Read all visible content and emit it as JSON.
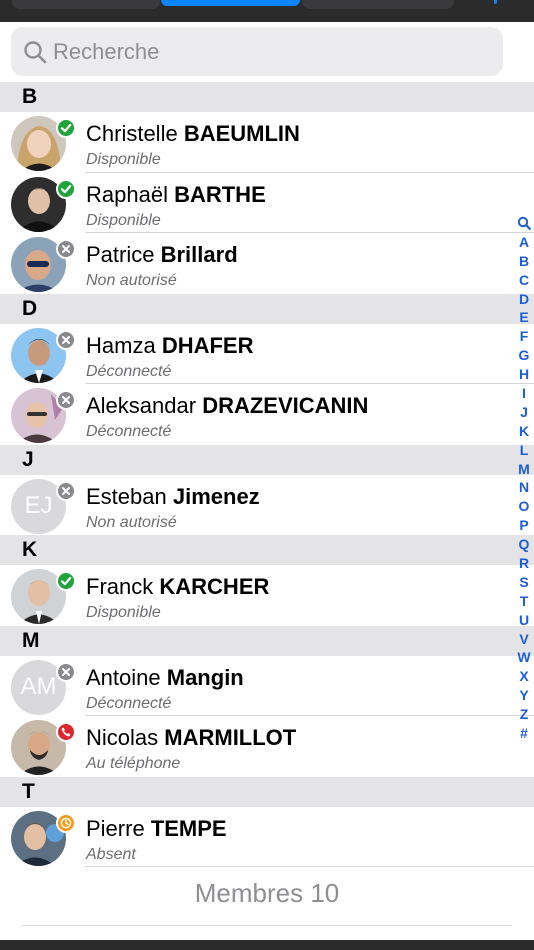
{
  "search": {
    "placeholder": "Recherche"
  },
  "sections": [
    {
      "letter": "B",
      "contacts": [
        {
          "first": "Christelle",
          "last": "BAEUMLIN",
          "state": "Disponible",
          "status": "ok",
          "initials": ""
        },
        {
          "first": "Raphaël",
          "last": "BARTHE",
          "state": "Disponible",
          "status": "ok",
          "initials": ""
        },
        {
          "first": "Patrice",
          "last": "Brillard",
          "state": "Non autorisé",
          "status": "off",
          "initials": ""
        }
      ]
    },
    {
      "letter": "D",
      "contacts": [
        {
          "first": "Hamza",
          "last": "DHAFER",
          "state": "Déconnecté",
          "status": "off",
          "initials": ""
        },
        {
          "first": "Aleksandar",
          "last": "DRAZEVICANIN",
          "state": "Déconnecté",
          "status": "off",
          "initials": ""
        }
      ]
    },
    {
      "letter": "J",
      "contacts": [
        {
          "first": "Esteban",
          "last": "Jimenez",
          "state": "Non autorisé",
          "status": "off",
          "initials": "EJ"
        }
      ]
    },
    {
      "letter": "K",
      "contacts": [
        {
          "first": "Franck",
          "last": "KARCHER",
          "state": "Disponible",
          "status": "ok",
          "initials": ""
        }
      ]
    },
    {
      "letter": "M",
      "contacts": [
        {
          "first": "Antoine",
          "last": "Mangin",
          "state": "Déconnecté",
          "status": "off",
          "initials": "AM"
        },
        {
          "first": "Nicolas",
          "last": "MARMILLOT",
          "state": "Au téléphone",
          "status": "phone",
          "initials": ""
        }
      ]
    },
    {
      "letter": "T",
      "contacts": [
        {
          "first": "Pierre",
          "last": "TEMPE",
          "state": "Absent",
          "status": "away",
          "initials": ""
        }
      ]
    }
  ],
  "index": [
    "search-icon",
    "A",
    "B",
    "C",
    "D",
    "E",
    "F",
    "G",
    "H",
    "I",
    "J",
    "K",
    "L",
    "M",
    "N",
    "O",
    "P",
    "Q",
    "R",
    "S",
    "T",
    "U",
    "V",
    "W",
    "X",
    "Y",
    "Z",
    "#"
  ],
  "footer": {
    "members": "Membres 10"
  },
  "colors": {
    "accent": "#0a84ff",
    "index": "#1a5fd6",
    "available": "#20a33a",
    "offline": "#8a8a8e",
    "phone": "#e0242e",
    "away": "#f39b1c"
  }
}
